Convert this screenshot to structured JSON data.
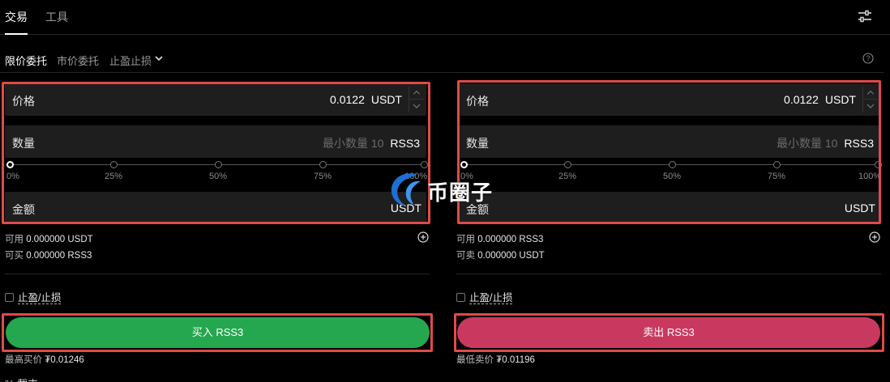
{
  "top_tabs": {
    "trade": "交易",
    "tools": "工具"
  },
  "order_tabs": {
    "limit": "限价委托",
    "market": "市价委托",
    "tpsl": "止盈止损"
  },
  "buy": {
    "price_label": "价格",
    "price_value": "0.0122",
    "price_unit": "USDT",
    "amount_label": "数量",
    "amount_placeholder": "最小数量 10",
    "amount_unit": "RSS3",
    "total_label": "金额",
    "total_unit": "USDT",
    "available_label": "可用",
    "available_value": "0.000000 USDT",
    "can_buy_label": "可买",
    "can_buy_value": "0.000000 RSS3",
    "tpsl_label": "止盈/止损",
    "button_label": "买入 RSS3",
    "best_label": "最高买价",
    "best_value": "₮0.01246"
  },
  "sell": {
    "price_label": "价格",
    "price_value": "0.0122",
    "price_unit": "USDT",
    "amount_label": "数量",
    "amount_placeholder": "最小数量 10",
    "amount_unit": "RSS3",
    "total_label": "金额",
    "total_unit": "USDT",
    "available_label": "可用",
    "available_value": "0.000000 RSS3",
    "can_sell_label": "可卖",
    "can_sell_value": "0.000000 USDT",
    "tpsl_label": "止盈/止损",
    "button_label": "卖出 RSS3",
    "best_label": "最低卖价",
    "best_value": "₮0.01196"
  },
  "slider_ticks": [
    "0%",
    "25%",
    "50%",
    "75%",
    "100%"
  ],
  "watermark_text": "币圈子",
  "cutoff_text": "% 截丰",
  "colors": {
    "buy": "#25a750",
    "sell": "#c9395f",
    "highlight": "#e04a4a"
  }
}
